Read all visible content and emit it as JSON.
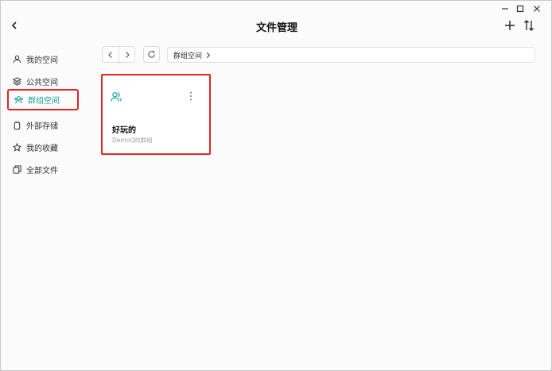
{
  "window": {
    "controls": [
      "minimize",
      "maximize",
      "close"
    ]
  },
  "header": {
    "title": "文件管理",
    "back_icon": "chevron-left-icon",
    "add_icon": "plus-icon",
    "sort_icon": "sort-icon"
  },
  "sidebar": {
    "items": [
      {
        "label": "我的空间",
        "icon": "user-icon",
        "active": false
      },
      {
        "label": "公共空间",
        "icon": "layers-icon",
        "active": false
      },
      {
        "label": "群组空间",
        "icon": "group-icon",
        "active": true
      },
      {
        "label": "外部存储",
        "icon": "drive-icon",
        "active": false
      },
      {
        "label": "我的收藏",
        "icon": "star-icon",
        "active": false
      },
      {
        "label": "全部文件",
        "icon": "files-icon",
        "active": false
      }
    ]
  },
  "toolbar": {
    "breadcrumb": "群组空间"
  },
  "groups": [
    {
      "name": "好玩的",
      "owner": "DemoQ的群组",
      "icon": "group-icon",
      "menu_icon": "more-vertical-icon"
    }
  ],
  "colors": {
    "accent": "#1aa39a",
    "highlight": "#e02626"
  }
}
